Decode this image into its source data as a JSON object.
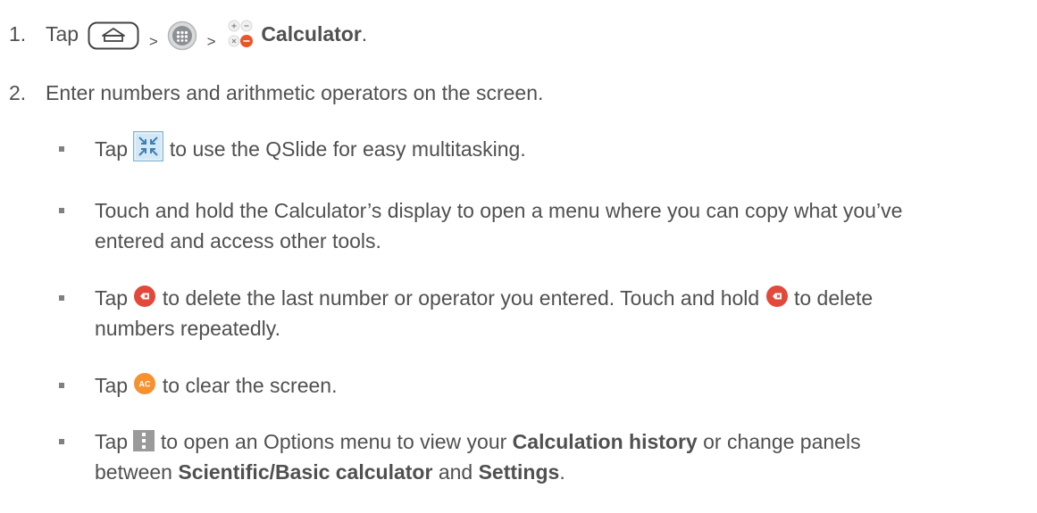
{
  "step1": {
    "number": "1.",
    "tap": "Tap",
    "sep1": ">",
    "sep2": ">",
    "app_name": "Calculator",
    "end": "."
  },
  "step2": {
    "number": "2.",
    "text": "Enter numbers and arithmetic operators on the screen."
  },
  "bullet_qslide": {
    "before": "Tap",
    "after": "to use the QSlide for easy multitasking."
  },
  "bullet_display": {
    "line1": "Touch and hold the Calculator’s display to open a menu where you can copy what you’ve",
    "line2": "entered and access other tools."
  },
  "bullet_delete": {
    "before": "Tap",
    "middle": "to delete the last number or operator you entered. Touch and hold",
    "after": "to delete",
    "line2": "numbers repeatedly."
  },
  "bullet_clear": {
    "before": "Tap",
    "icon_label": "AC",
    "after": "to clear the screen."
  },
  "bullet_options": {
    "before": "Tap",
    "middle": "to open an Options menu to view your",
    "history": "Calculation history",
    "after": "or change panels",
    "line2_start": "between",
    "scientific": "Scientific/Basic calculator",
    "and": "and",
    "settings": "Settings",
    "end": "."
  },
  "colors": {
    "text": "#505050",
    "delete_red": "#e2493b",
    "ac_orange": "#f7902f",
    "qslide_blue": "#7fb6da",
    "menu_grey": "#9a9a9a"
  }
}
